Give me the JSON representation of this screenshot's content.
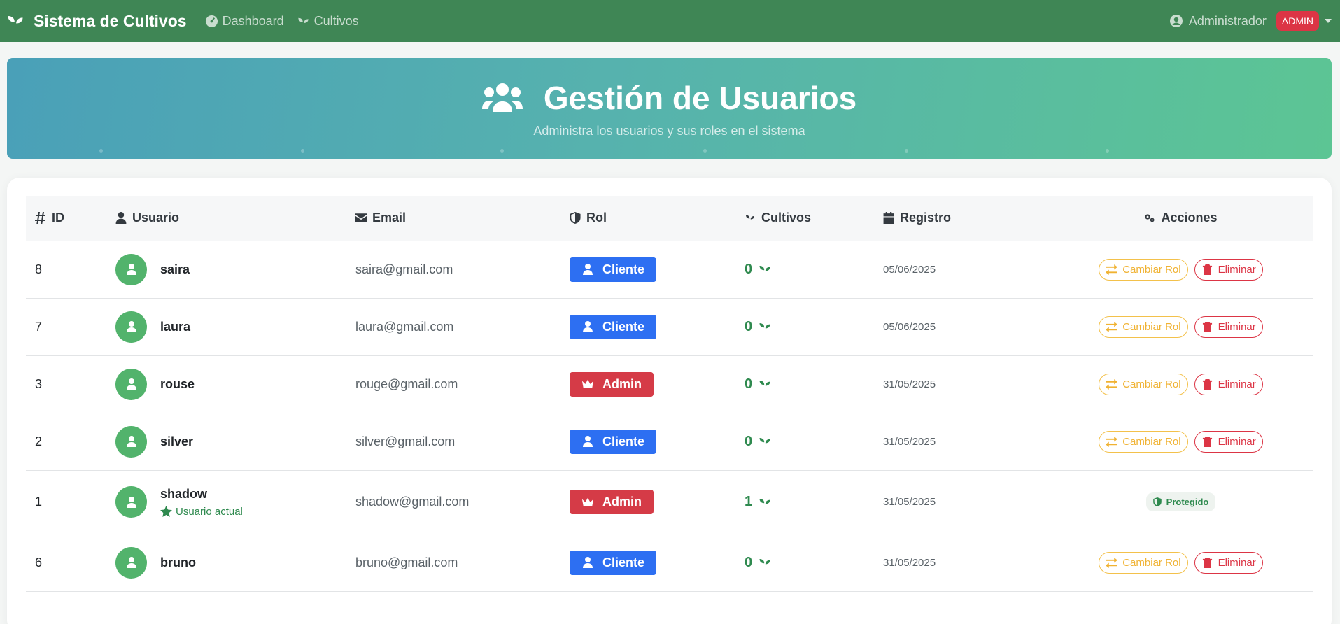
{
  "navbar": {
    "brand": "Sistema de Cultivos",
    "links": [
      {
        "label": "Dashboard",
        "icon": "gauge-icon"
      },
      {
        "label": "Cultivos",
        "icon": "seedling-icon"
      }
    ],
    "user_name": "Administrador",
    "role_badge": "ADMIN"
  },
  "header": {
    "title": "Gestión de Usuarios",
    "subtitle": "Administra los usuarios y sus roles en el sistema"
  },
  "table": {
    "columns": {
      "id": "ID",
      "user": "Usuario",
      "email": "Email",
      "role": "Rol",
      "crops": "Cultivos",
      "registered": "Registro",
      "actions": "Acciones"
    },
    "rows": [
      {
        "id": "8",
        "name": "saira",
        "email": "saira@gmail.com",
        "role": "Cliente",
        "crops": "0",
        "date": "05/06/2025",
        "change_role": "Cambiar Rol",
        "delete": "Eliminar"
      },
      {
        "id": "7",
        "name": "laura",
        "email": "laura@gmail.com",
        "role": "Cliente",
        "crops": "0",
        "date": "05/06/2025",
        "change_role": "Cambiar Rol",
        "delete": "Eliminar"
      },
      {
        "id": "3",
        "name": "rouse",
        "email": "rouge@gmail.com",
        "role": "Admin",
        "crops": "0",
        "date": "31/05/2025",
        "change_role": "Cambiar Rol",
        "delete": "Eliminar"
      },
      {
        "id": "2",
        "name": "silver",
        "email": "silver@gmail.com",
        "role": "Cliente",
        "crops": "0",
        "date": "31/05/2025",
        "change_role": "Cambiar Rol",
        "delete": "Eliminar"
      },
      {
        "id": "1",
        "name": "shadow",
        "current_user": "Usuario actual",
        "email": "shadow@gmail.com",
        "role": "Admin",
        "crops": "1",
        "date": "31/05/2025",
        "protected": "Protegido"
      },
      {
        "id": "6",
        "name": "bruno",
        "email": "bruno@gmail.com",
        "role": "Cliente",
        "crops": "0",
        "date": "31/05/2025",
        "change_role": "Cambiar Rol",
        "delete": "Eliminar"
      }
    ]
  },
  "colors": {
    "navbar": "#3f8655",
    "cliente": "#2d6ff2",
    "admin": "#d53b47",
    "success": "#2f8a4f",
    "warning": "#f0b232",
    "danger": "#dc3545"
  }
}
